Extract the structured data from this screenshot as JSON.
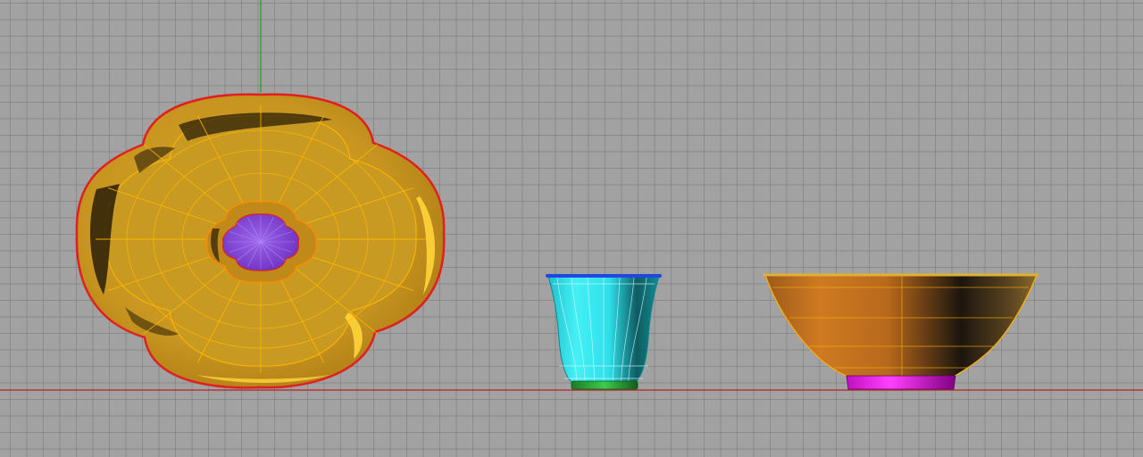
{
  "viewport": {
    "label": "",
    "background": "#a2a2a2",
    "grid_line_color": "#8a8a8a",
    "x_axis_color": "#b22222",
    "y_axis_color": "#1f9e2a"
  },
  "objects": [
    {
      "name": "lobed-dish",
      "view": "top",
      "colors": {
        "body": "#d9a928",
        "shade": "#2a1d08",
        "highlight": "#ffd43a",
        "rim": "#e02020",
        "wire": "#ffb800",
        "center": "#8a4fd8"
      }
    },
    {
      "name": "cup",
      "view": "side",
      "colors": {
        "body": "#35e6ee",
        "shade": "#0c3d42",
        "wire": "#d0f8ff",
        "rim": "#2047e0",
        "foot": "#2aa63a"
      }
    },
    {
      "name": "bowl",
      "view": "side",
      "colors": {
        "body": "#c8711e",
        "shade": "#1a140c",
        "wire": "#ffb000",
        "rim": "#e0b030",
        "foot": "#e01ee0"
      }
    }
  ]
}
